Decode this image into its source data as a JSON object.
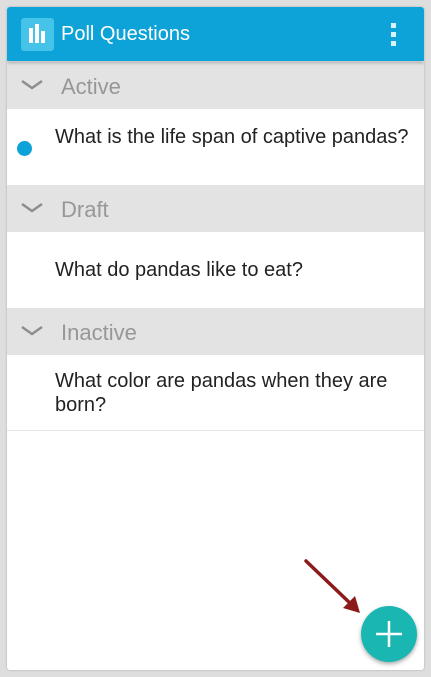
{
  "app_bar": {
    "title": "Poll Questions",
    "icon": "bar-chart-icon",
    "menu_icon": "overflow-menu-icon",
    "color": "#0ea3d8"
  },
  "sections": [
    {
      "label": "Active",
      "items": [
        {
          "text": "What is the life span of captive pandas?",
          "status_color": "#0ea3d8"
        }
      ]
    },
    {
      "label": "Draft",
      "items": [
        {
          "text": "What do pandas like to eat?"
        }
      ]
    },
    {
      "label": "Inactive",
      "items": [
        {
          "text": "What color are pandas when they are born?"
        }
      ]
    }
  ],
  "fab": {
    "icon": "plus-icon",
    "color": "#19b6b2"
  },
  "annotation": {
    "icon": "pointer-arrow-icon",
    "color": "#8b1a1a"
  }
}
